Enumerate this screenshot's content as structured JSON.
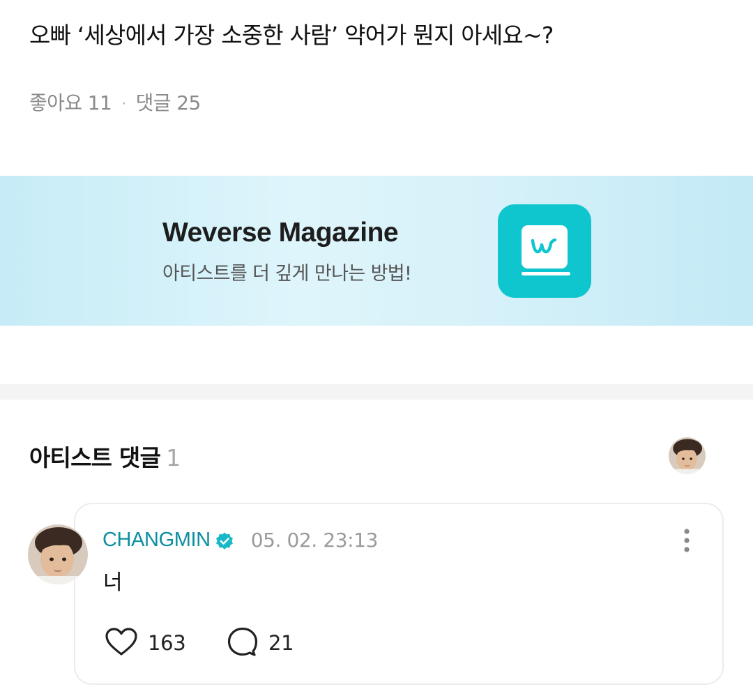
{
  "post": {
    "title": "오빠 ‘세상에서 가장 소중한 사람’ 약어가 뭔지 아세요~?",
    "likes_label": "좋아요 11",
    "comments_label": "댓글 25"
  },
  "banner": {
    "title": "Weverse Magazine",
    "subtitle": "아티스트를 더 깊게 만나는 방법!",
    "app_icon": "weverse-magazine-icon",
    "colors": {
      "background": "#d6f1f9",
      "app_icon": "#0fc6cf"
    }
  },
  "artist_comments": {
    "title": "아티스트 댓글",
    "count": "1",
    "avatar_icon": "artist-avatar"
  },
  "comment": {
    "author": "CHANGMIN",
    "verified_icon": "verified-badge-icon",
    "timestamp": "05. 02. 23:13",
    "text": "너",
    "like_count": "163",
    "reply_count": "21",
    "colors": {
      "author": "#0c8fa0",
      "verified": "#17b8c8"
    }
  }
}
